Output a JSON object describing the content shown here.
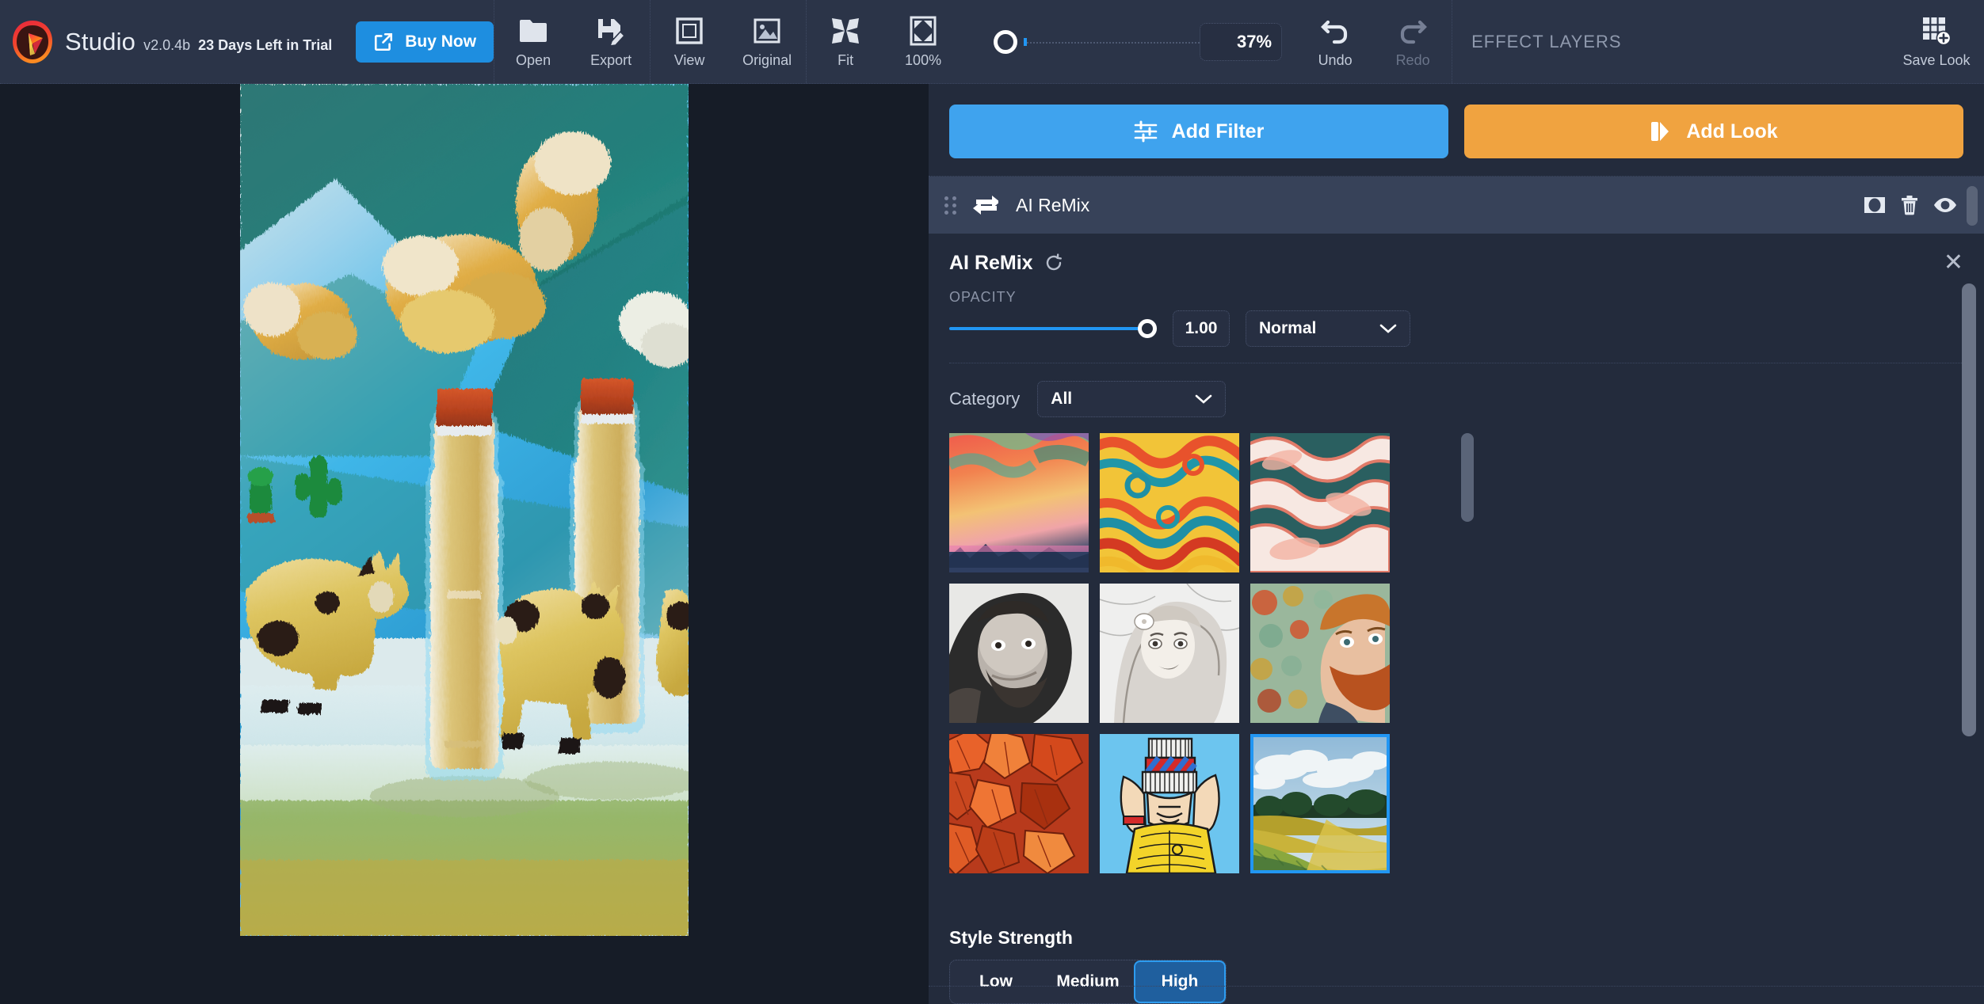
{
  "app": {
    "name": "Studio",
    "version": "v2.0.4b",
    "trial_text": "23 Days Left in Trial",
    "buy_label": "Buy Now",
    "logo_icon": "pick-crystal-logo"
  },
  "toolbar": {
    "file_tools": [
      {
        "label": "Open",
        "icon": "folder-icon"
      },
      {
        "label": "Export",
        "icon": "save-pencil-icon"
      }
    ],
    "view_tools": [
      {
        "label": "View",
        "icon": "frame-icon"
      },
      {
        "label": "Original",
        "icon": "photo-icon"
      }
    ],
    "zoom_tools": [
      {
        "label": "Fit",
        "icon": "fit-arrows-icon"
      },
      {
        "label": "100%",
        "icon": "expand-corners-icon"
      }
    ],
    "zoom_value": "37%",
    "zoom_slider_position_pct": 7,
    "history": [
      {
        "label": "Undo",
        "icon": "undo-arrow-icon",
        "enabled": true
      },
      {
        "label": "Redo",
        "icon": "redo-arrow-icon",
        "enabled": false
      }
    ],
    "save_look": {
      "label": "Save Look",
      "icon": "grid-plus-icon"
    }
  },
  "right_panel": {
    "header_title": "EFFECT LAYERS",
    "add_filter_label": "Add Filter",
    "add_filter_icon": "sliders-icon",
    "add_look_label": "Add Look",
    "add_look_icon": "look-flag-icon",
    "layers": [
      {
        "name": "AI ReMix",
        "drag_icon": "drag-grip-icon",
        "type_icon": "swap-arrows-icon",
        "mask_icon": "mask-icon",
        "delete_icon": "trash-icon",
        "visibility_icon": "eye-icon"
      }
    ],
    "properties": {
      "title": "AI ReMix",
      "reset_icon": "reset-circular-arrow-icon",
      "close_icon": "close-x-icon",
      "opacity_label": "OPACITY",
      "opacity_value": "1.00",
      "opacity_pct": 100,
      "blend_mode": "Normal",
      "blend_chevron_icon": "chevron-down-icon",
      "category_label": "Category",
      "category_value": "All",
      "category_chevron_icon": "chevron-down-icon",
      "styles": [
        {
          "name": "sunset-sky",
          "selected": false
        },
        {
          "name": "swirl-fire-abstract",
          "selected": false
        },
        {
          "name": "pink-tangle",
          "selected": false
        },
        {
          "name": "bearded-man-bw",
          "selected": false
        },
        {
          "name": "woman-pencil-sketch",
          "selected": false
        },
        {
          "name": "redhead-portrait",
          "selected": false
        },
        {
          "name": "autumn-leaves",
          "selected": false
        },
        {
          "name": "comic-child-yellow",
          "selected": false
        },
        {
          "name": "impressionist-landscape",
          "selected": true
        }
      ],
      "strength_title": "Style Strength",
      "strength_options": [
        "Low",
        "Medium",
        "High"
      ],
      "strength_selected": "High"
    }
  },
  "canvas": {
    "document_name": "stylized-bottles-and-cows",
    "zoom_percent": "37%"
  },
  "colors": {
    "topbar_bg": "#2b3448",
    "panel_bg": "#232b3c",
    "canvas_bg": "#161c27",
    "accent_blue": "#2196f3",
    "buy_blue": "#1e8ee0",
    "add_filter_blue": "#3fa3ee",
    "add_look_orange": "#f0a340",
    "layer_row_bg": "#374259",
    "selected_seg": "#1f5f9e"
  }
}
